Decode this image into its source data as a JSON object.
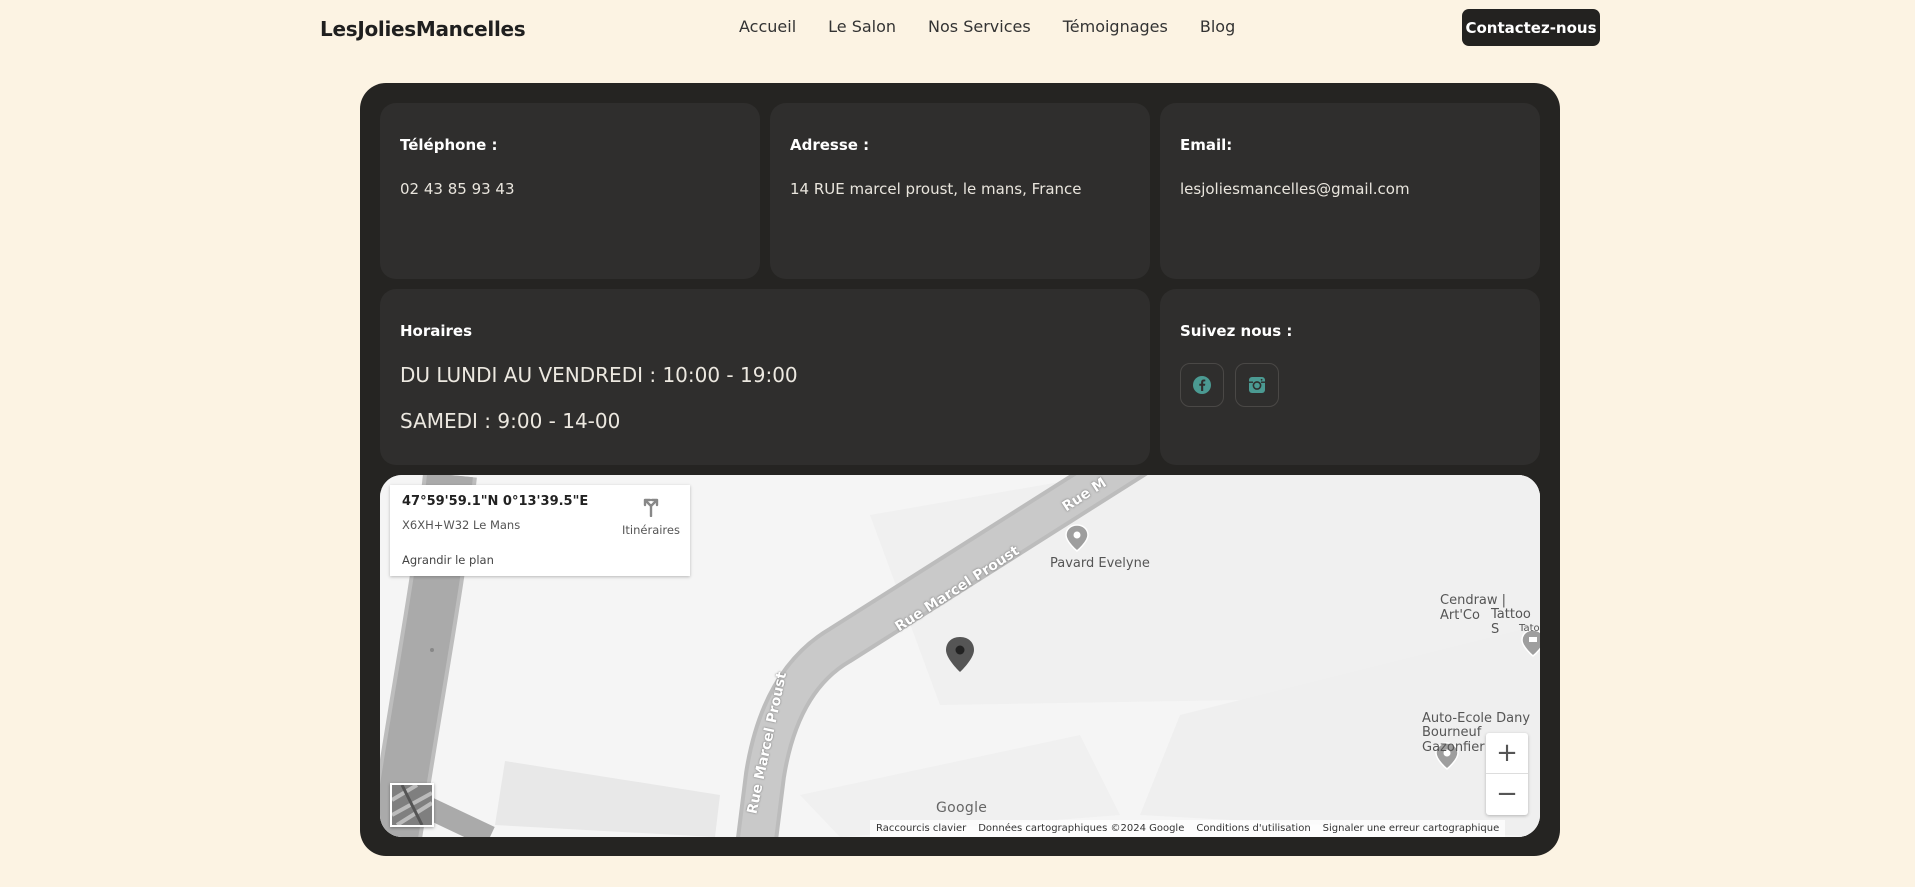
{
  "nav": {
    "brand": "LesJoliesMancelles",
    "links": [
      "Accueil",
      "Le Salon",
      "Nos Services",
      "Témoignages",
      "Blog"
    ],
    "cta": "Contactez-nous"
  },
  "contact": {
    "phone": {
      "label": "Téléphone :",
      "value": "02 43 85 93 43"
    },
    "address": {
      "label": "Adresse :",
      "value": "14 RUE marcel proust, le mans, France"
    },
    "email": {
      "label": "Email:",
      "value": "lesjoliesmancelles@gmail.com"
    },
    "hours": {
      "label": "Horaires",
      "line1": "DU LUNDI AU VENDREDI  : 10:00 - 19:00",
      "line2": "SAMEDI : 9:00 - 14-00"
    },
    "social": {
      "label": "Suivez nous :",
      "icons": [
        "facebook-icon",
        "instagram-icon"
      ],
      "icon_color": "#4b9a92"
    }
  },
  "map": {
    "coords": "47°59'59.1\"N 0°13'39.5\"E",
    "plus_code": "X6XH+W32 Le Mans",
    "directions": "Itinéraires",
    "enlarge": "Agrandir le plan",
    "pois": [
      "Pavard Evelyne",
      "Cendraw | Art'Co",
      "Tattoo S",
      "Tato",
      "Auto-Ecole Dany",
      "Bourneuf Gazonfier"
    ],
    "roads": [
      "Rue Marcel Proust",
      "Rue Marcel Proust",
      "Rue M"
    ],
    "logo": "Google",
    "attribution": [
      "Raccourcis clavier",
      "Données cartographiques ©2024 Google",
      "Conditions d'utilisation",
      "Signaler une erreur cartographique"
    ]
  }
}
